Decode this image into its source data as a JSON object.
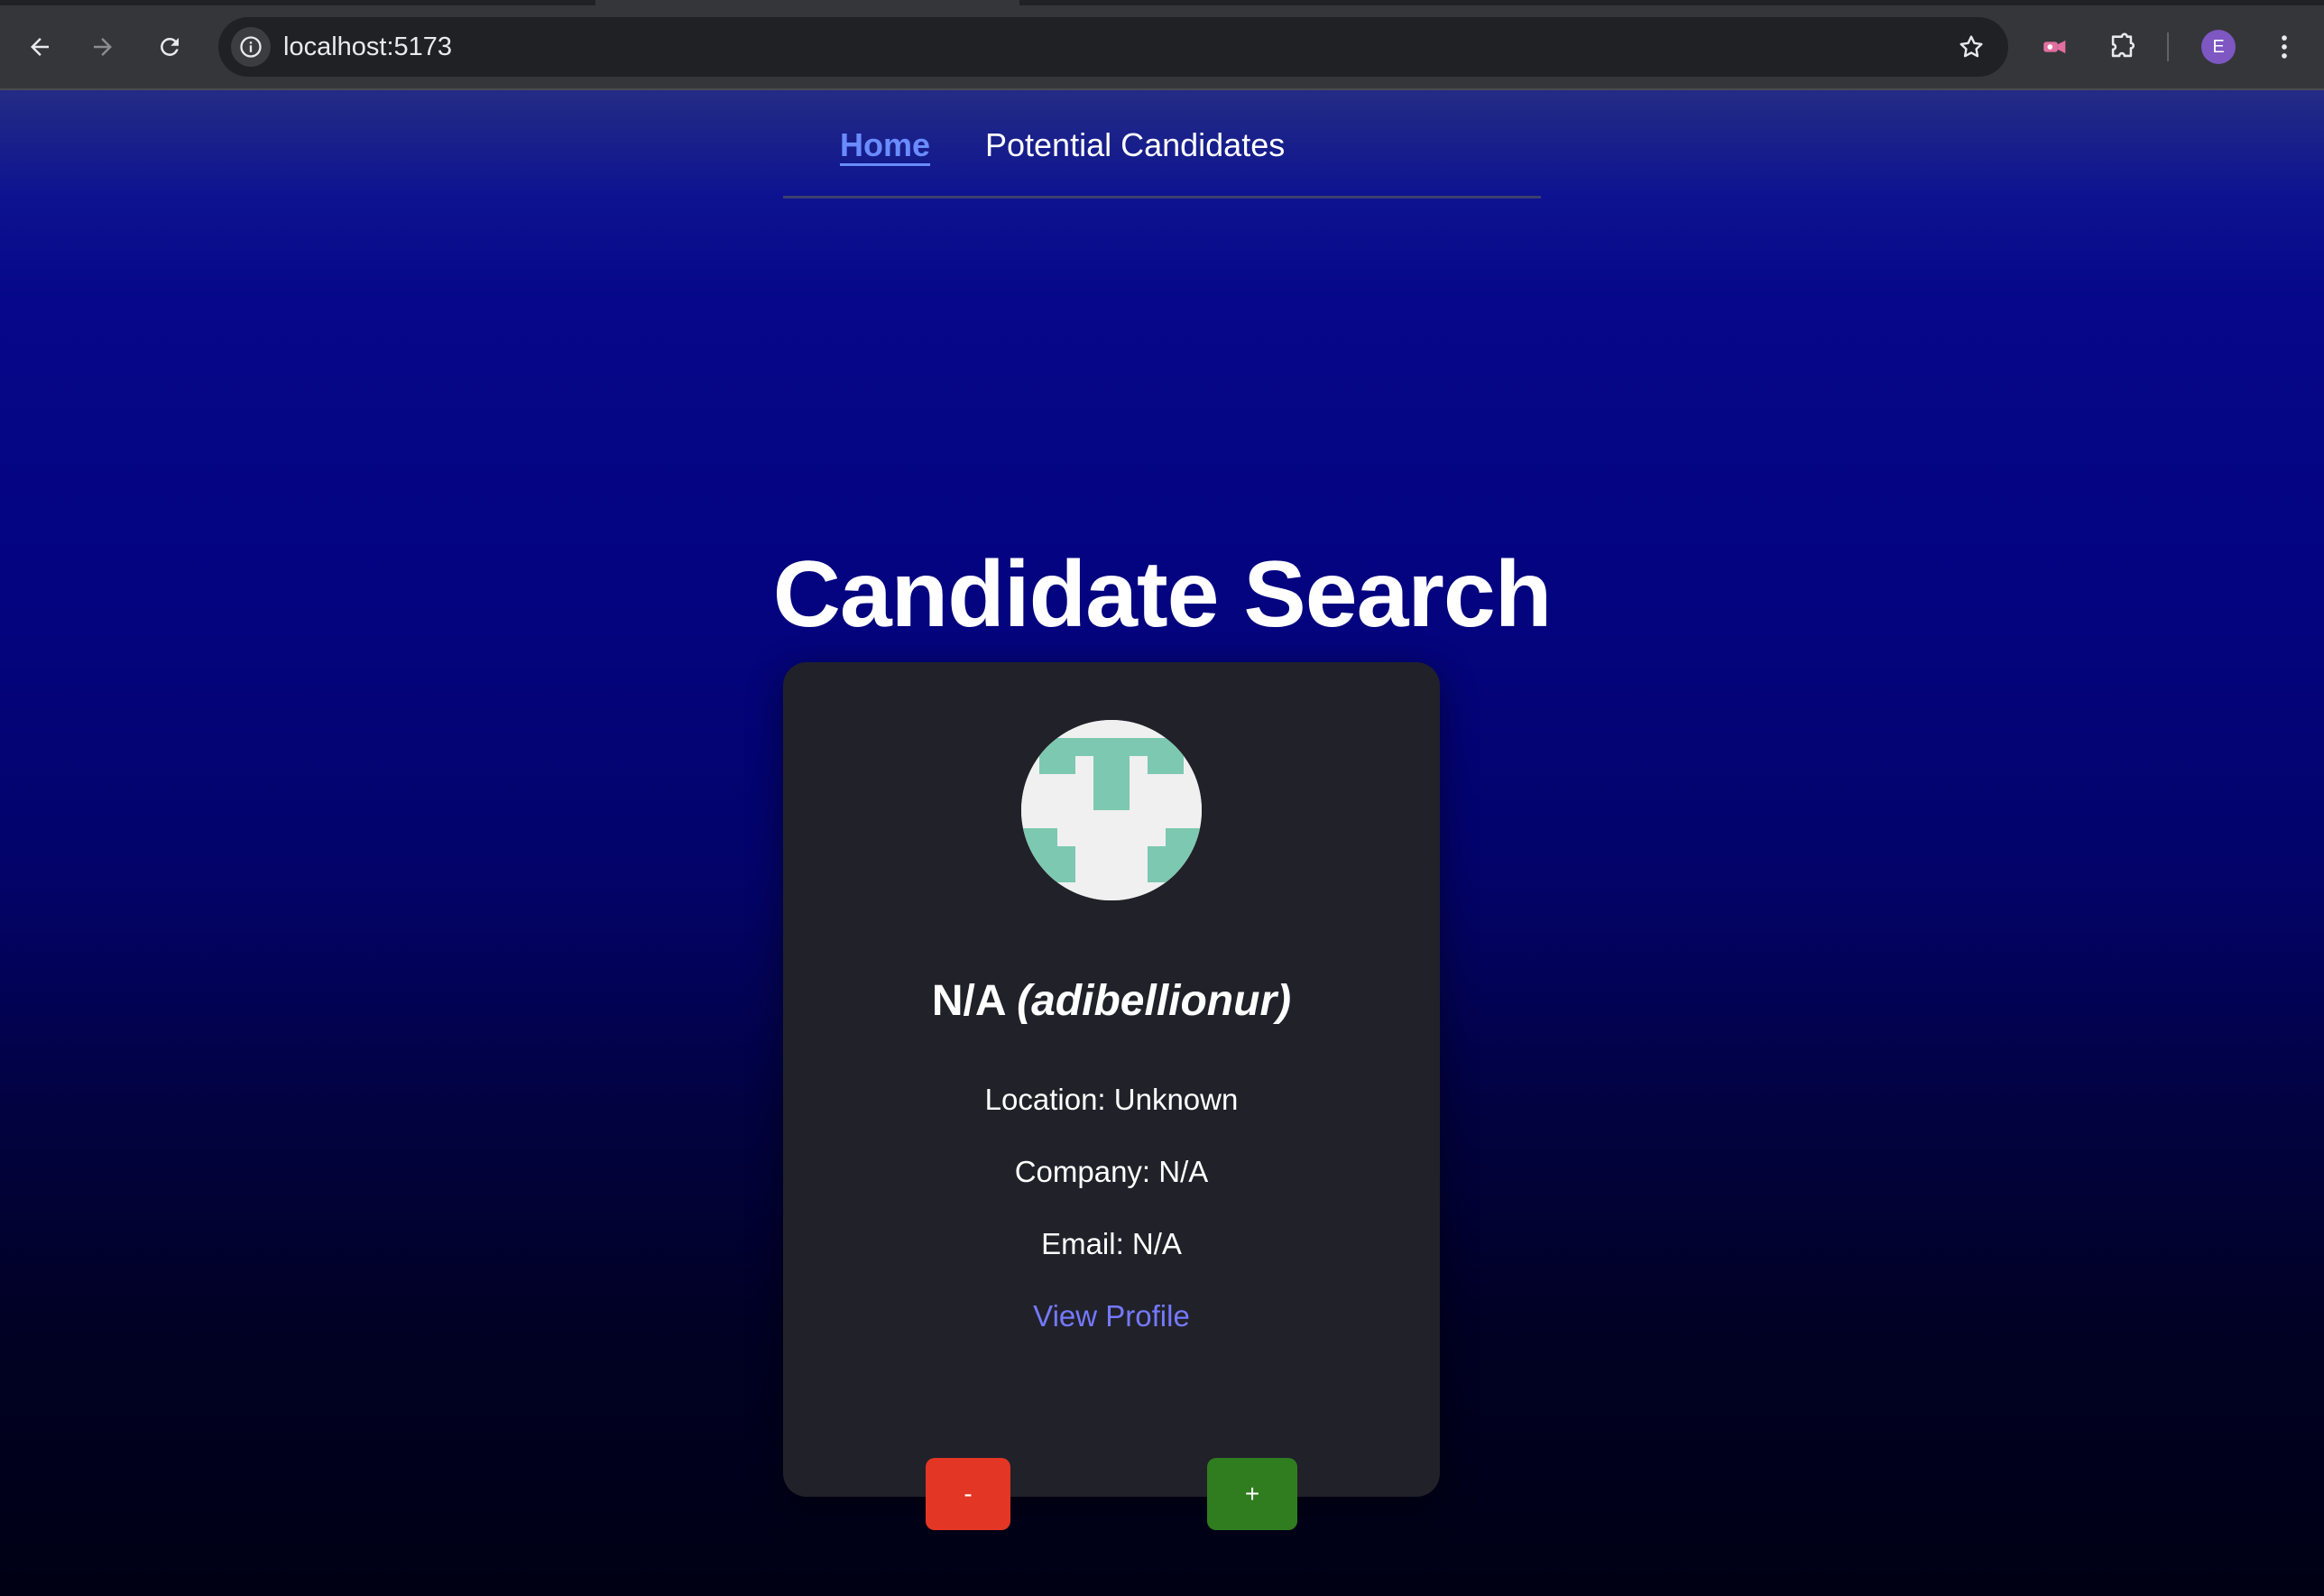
{
  "browser": {
    "url": "localhost:5173",
    "profile_initial": "E",
    "icons": [
      "back-icon",
      "forward-icon",
      "reload-icon",
      "site-info-icon",
      "star-icon",
      "extension-cast-icon",
      "puzzle-icon",
      "kebab-menu-icon"
    ]
  },
  "nav": {
    "home_label": "Home",
    "candidates_label": "Potential Candidates",
    "active_color": "#6a8cff"
  },
  "main": {
    "title": "Candidate Search"
  },
  "candidate": {
    "name": "N/A",
    "login": "(adibellionur)",
    "location_text": "Location: Unknown",
    "company_text": "Company: N/A",
    "email_text": "Email: N/A",
    "profile_link_label": "View Profile",
    "avatar_colors": {
      "background": "#f0f0f0",
      "pattern": "#7dc8b0"
    }
  },
  "actions": {
    "reject_label": "-",
    "accept_label": "+",
    "reject_color": "#e33624",
    "accept_color": "#2f7d1f"
  }
}
